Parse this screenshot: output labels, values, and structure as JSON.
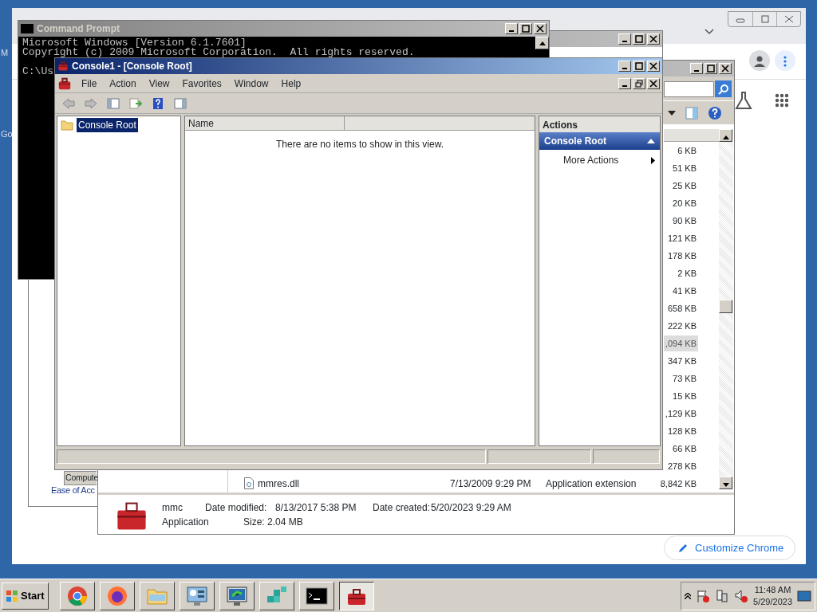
{
  "desktop_labels": [
    "M",
    "Go"
  ],
  "browser_window": {
    "customize_button": "Customize Chrome"
  },
  "control_panel_window": {
    "tree_item": "Compute",
    "link": "Ease of Acc"
  },
  "explorer_window": {
    "rows": [
      {
        "size": "6 KB",
        "selected": false
      },
      {
        "size": "51 KB",
        "selected": false
      },
      {
        "size": "25 KB",
        "selected": false
      },
      {
        "size": "20 KB",
        "selected": false
      },
      {
        "size": "90 KB",
        "selected": false
      },
      {
        "size": "121 KB",
        "selected": false
      },
      {
        "size": "178 KB",
        "selected": false
      },
      {
        "size": "2 KB",
        "selected": false
      },
      {
        "size": "41 KB",
        "selected": false
      },
      {
        "size": "658 KB",
        "selected": false
      },
      {
        "size": "222 KB",
        "selected": false
      },
      {
        "size": ",094 KB",
        "selected": true
      },
      {
        "size": "347 KB",
        "selected": false
      },
      {
        "size": "73 KB",
        "selected": false
      },
      {
        "size": "15 KB",
        "selected": false
      },
      {
        "size": ",129 KB",
        "selected": false
      },
      {
        "size": "128 KB",
        "selected": false
      },
      {
        "size": "66 KB",
        "selected": false
      },
      {
        "size": "278 KB",
        "selected": false
      },
      {
        "name": "mmres.dll",
        "date": "7/13/2009 9:29 PM",
        "type": "Application extension",
        "size": "8,842 KB",
        "selected": false
      }
    ],
    "details": {
      "name": "mmc",
      "type": "Application",
      "modified_label": "Date modified:",
      "modified": "8/13/2017 5:38 PM",
      "created_label": "Date created:",
      "created": "5/20/2023 9:29 AM",
      "size_label": "Size:",
      "size": "2.04 MB"
    }
  },
  "command_prompt": {
    "title": "Command Prompt",
    "lines": [
      "Microsoft Windows [Version 6.1.7601]",
      "Copyright (c) 2009 Microsoft Corporation.  All rights reserved.",
      "C:\\Us"
    ]
  },
  "console_window": {
    "title": "Console1 - [Console Root]",
    "menu": [
      "File",
      "Action",
      "View",
      "Favorites",
      "Window",
      "Help"
    ],
    "tree": [
      {
        "label": "Console Root",
        "selected": true
      }
    ],
    "columns": [
      "Name"
    ],
    "empty_message": "There are no items to show in this view.",
    "actions": {
      "title": "Actions",
      "section": "Console Root",
      "expanded": true,
      "items": [
        "More Actions"
      ]
    }
  },
  "taskbar": {
    "start": "Start",
    "apps": [
      {
        "kind": "chrome",
        "selected": false
      },
      {
        "kind": "firefox",
        "selected": false
      },
      {
        "kind": "folder",
        "selected": false
      },
      {
        "kind": "control",
        "selected": false
      },
      {
        "kind": "monitor",
        "selected": false
      },
      {
        "kind": "cubes",
        "selected": false
      },
      {
        "kind": "terminal",
        "selected": false
      },
      {
        "kind": "toolbox",
        "selected": true
      }
    ],
    "time": "11:48 AM",
    "date": "5/29/2023"
  }
}
